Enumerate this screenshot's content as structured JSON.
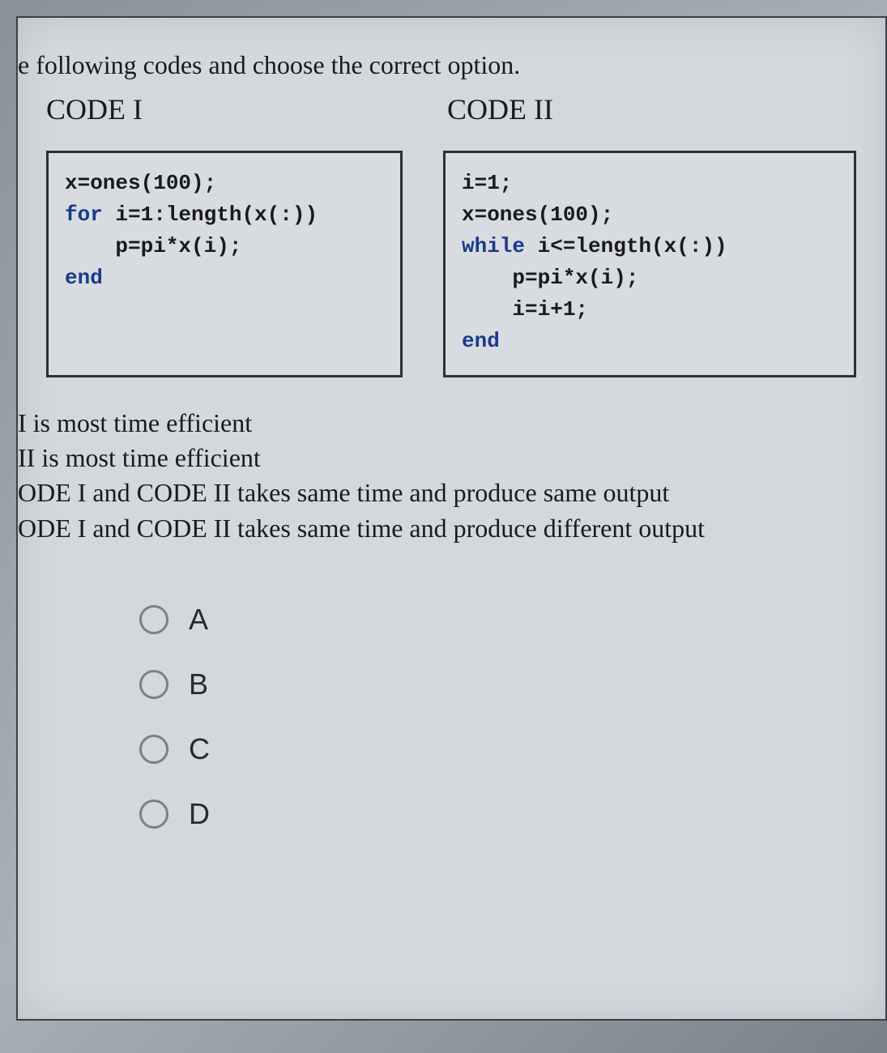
{
  "question": "e following codes and choose the correct option.",
  "headers": {
    "code1": "CODE I",
    "code2": "CODE II"
  },
  "code1": {
    "line1": "x=ones(100);",
    "line2_kw": "for",
    "line2_rest": " i=1:length(x(:))",
    "line3": "    p=pi*x(i);",
    "line4_kw": "end"
  },
  "code2": {
    "line1": "i=1;",
    "line2": "x=ones(100);",
    "line3_kw": "while",
    "line3_rest": " i<=length(x(:))",
    "line4": "    p=pi*x(i);",
    "line5": "    i=i+1;",
    "line6_kw": "end"
  },
  "answers": {
    "a": "I is most time efficient",
    "b": "II is most time efficient",
    "c": "ODE I and CODE II takes same time and produce same output",
    "d": "ODE I and CODE II takes same time and produce different output"
  },
  "options": {
    "a": "A",
    "b": "B",
    "c": "C",
    "d": "D"
  }
}
